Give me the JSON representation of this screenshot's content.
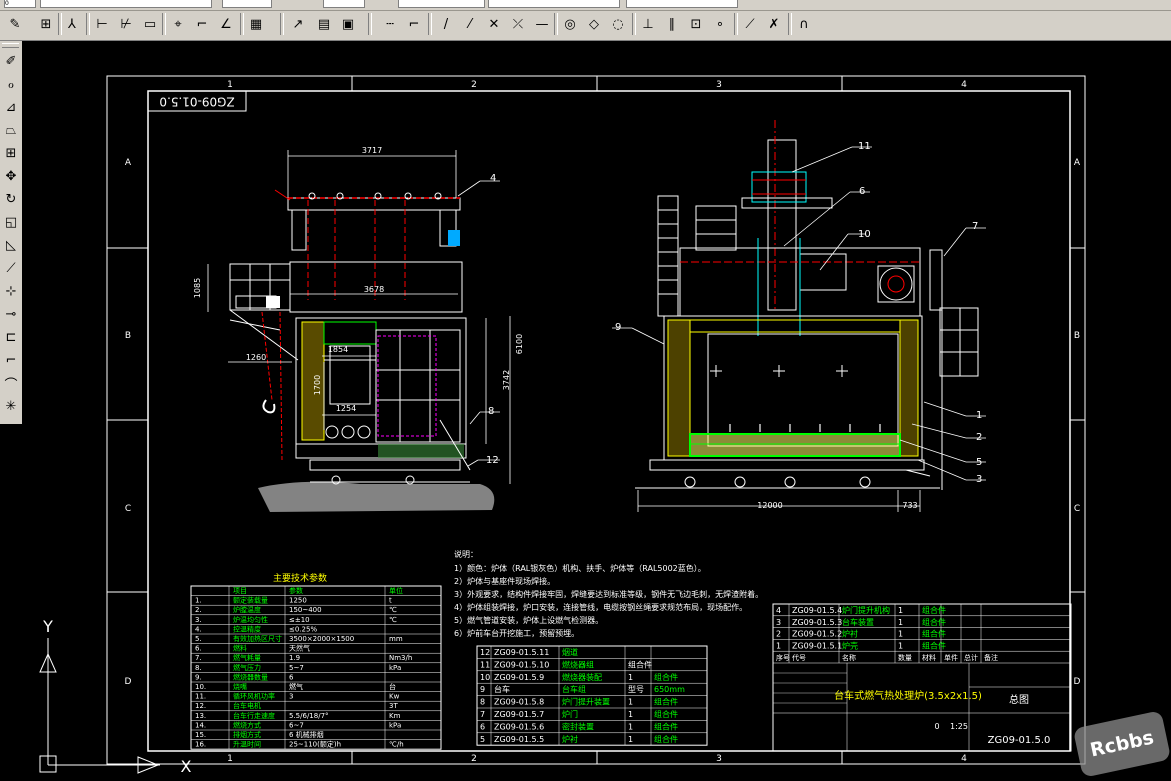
{
  "toolbar": {
    "combos": [
      {
        "value": "0"
      },
      {
        "value": ""
      },
      {
        "value": ""
      },
      {
        "value": ""
      },
      {
        "value": ""
      },
      {
        "value": ""
      }
    ]
  },
  "drawing": {
    "number_box": "ZG09-01.5.0",
    "col_labels": [
      "1",
      "2",
      "3",
      "4"
    ],
    "row_labels": [
      "A",
      "B",
      "C",
      "D"
    ],
    "dims_left": [
      "3717",
      "3678",
      "1854",
      "1254",
      "1260",
      "1085",
      "6100",
      "3742",
      "1700"
    ],
    "dims_right": [
      "12000",
      "733"
    ],
    "callouts": [
      "4",
      "8",
      "12",
      "11",
      "6",
      "10",
      "7",
      "9",
      "1",
      "2",
      "5",
      "3"
    ],
    "notes_title": "说明：",
    "notes": [
      "1）颜色：炉体（RAL银灰色）机构、扶手、炉体等（RAL5002蓝色）。",
      "2）炉体与基座件现场焊接。",
      "3）外观要求，结构件焊接牢固，焊缝要达到标准等级，钢件无飞边毛刺，无焊渣附着。",
      "4）炉体组装焊接，炉口安装，连接管线，电缆按钢丝绳要求规范布局，现场配作。",
      "5）燃气管道安装，炉体上设燃气检测器。",
      "6）炉前车台开挖施工，预留预埋。"
    ],
    "spec_title": "主要技术参数",
    "spec_headers": [
      "",
      "项目",
      "参数",
      "单位"
    ],
    "spec_rows": [
      [
        "1.",
        "额定装载量",
        "1250",
        "t"
      ],
      [
        "2.",
        "炉膛温度",
        "150~400",
        "℃"
      ],
      [
        "3.",
        "炉温均匀性",
        "≤±10",
        "℃"
      ],
      [
        "4.",
        "控温精度",
        "≤0.25%",
        ""
      ],
      [
        "5.",
        "有效加热区尺寸",
        "3500×2000×1500",
        "mm"
      ],
      [
        "6.",
        "燃料",
        "天然气",
        ""
      ],
      [
        "7.",
        "燃气耗量",
        "1.9",
        "Nm3/h"
      ],
      [
        "8.",
        "燃气压力",
        "5~7",
        "kPa"
      ],
      [
        "9.",
        "燃烧器数量",
        "6",
        ""
      ],
      [
        "10.",
        "烧嘴",
        "燃气",
        "台"
      ],
      [
        "11.",
        "循环风机功率",
        "3",
        "Kw"
      ],
      [
        "12.",
        "台车电机",
        "",
        "3T"
      ],
      [
        "13.",
        "台车行走速度",
        "5.5/6/18/7°",
        "Km"
      ],
      [
        "14.",
        "燃烧方式",
        "6~7",
        "kPa"
      ],
      [
        "15.",
        "排烟方式",
        "6 机械排烟",
        ""
      ],
      [
        "16.",
        "升温时间",
        "25~110(额定)h",
        "℃/h"
      ]
    ],
    "parts_rows": [
      [
        "12",
        "ZG09-01.5.11",
        "烟道",
        "",
        ""
      ],
      [
        "11",
        "ZG09-01.5.10",
        "燃烧器组",
        "组合件",
        ""
      ],
      [
        "10",
        "ZG09-01.5.9",
        "燃烧器装配",
        "1",
        "组合件"
      ],
      [
        "9",
        "台车",
        "台车组",
        "型号",
        "650mm"
      ],
      [
        "8",
        "ZG09-01.5.8",
        "炉门提升装置",
        "1",
        "组合件"
      ],
      [
        "7",
        "ZG09-01.5.7",
        "炉门",
        "1",
        "组合件"
      ],
      [
        "6",
        "ZG09-01.5.6",
        "密封装置",
        "1",
        "组合件"
      ],
      [
        "5",
        "ZG09-01.5.5",
        "炉衬",
        "1",
        "组合件"
      ]
    ],
    "title_rows": [
      [
        "4",
        "ZG09-01.5.4",
        "炉门提升机构",
        "1",
        "组合件"
      ],
      [
        "3",
        "ZG09-01.5.3",
        "台车装置",
        "1",
        "组合件"
      ],
      [
        "2",
        "ZG09-01.5.2",
        "炉衬",
        "1",
        "组合件"
      ],
      [
        "1",
        "ZG09-01.5.1",
        "炉壳",
        "1",
        "组合件"
      ]
    ],
    "title_header": [
      "序号",
      "代号",
      "名称",
      "数量",
      "材料",
      "单件",
      "总计",
      "备注"
    ],
    "title_name": "台车式燃气热处理炉(3.5x2x1.5)",
    "title_sheet": "总图",
    "title_code": "ZG09-01.5.0",
    "scale": "1:25",
    "sheet_count": "0"
  },
  "ucs": {
    "y_label": "Y",
    "x_label": "X"
  },
  "watermark": "Rcbbs",
  "colors": {
    "background": "#000000",
    "frame": "#ffffff",
    "cyan": "#00ffff",
    "green": "#00ff00",
    "yellow": "#ffff00",
    "red": "#ff0000",
    "white": "#ffffff",
    "blue": "#0000ff",
    "magenta": "#ff00ff"
  }
}
